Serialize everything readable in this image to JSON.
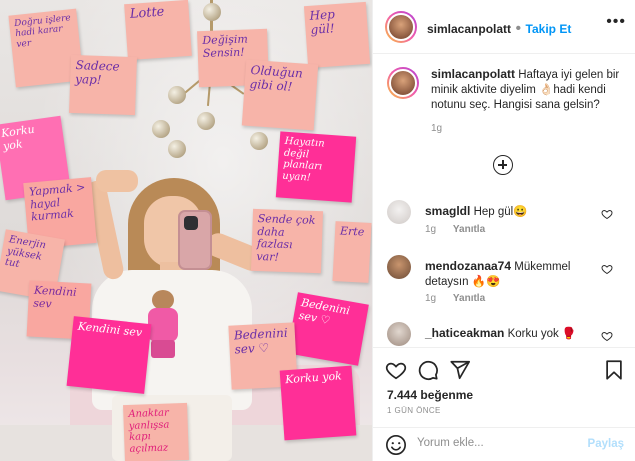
{
  "post": {
    "username": "simlacanpolatt",
    "follow_label": "Takip Et",
    "caption_username": "simlacanpolatt",
    "caption_text": "Haftaya iyi gelen bir minik aktivite diyelim 👌🏻hadi kendi notunu seç. Hangisi sana gelsin?",
    "caption_time": "1g",
    "likes": "7.444 beğenme",
    "date": "1 GÜN ÖNCE",
    "comment_placeholder": "Yorum ekle...",
    "post_label": "Paylaş"
  },
  "comments": [
    {
      "user": "smagldl",
      "text": "Hep gül😀",
      "time": "1g",
      "reply": "Yanıtla"
    },
    {
      "user": "mendozanaa74",
      "text": "Mükemmel detaysın 🔥😍",
      "time": "1g",
      "reply": "Yanıtla"
    },
    {
      "user": "_haticeakman",
      "text": "Korku yok 🥊"
    }
  ],
  "notes": {
    "n1": "Doğru işlere hadi karar ver",
    "n2": "Lotte",
    "n3": "Değişim Sensin!",
    "n4": "Hep gül!",
    "n5": "Sadece yap!",
    "n6": "Olduğun gibi ol!",
    "n7": "Korku yok",
    "n8": "Hayatın değil planları uyan!",
    "n9": "Yapmak > hayal kurmak",
    "n10": "Sende çok daha fazlası var!",
    "n11": "Enerjin yüksek tut",
    "n12": "Erte",
    "n13": "Kendini sev",
    "n14": "Bedenini sev ♡",
    "n15": "Anaktar yanlışsa kapı açılmaz"
  },
  "colors": {
    "accent_blue": "#0095f6",
    "note_peach": "#f7b4a9",
    "note_pink": "#ff6fb3",
    "note_hot": "#ff2f97"
  },
  "icons": [
    "heart-icon",
    "comment-icon",
    "share-icon",
    "bookmark-icon",
    "emoji-icon",
    "more-icon",
    "add-circle-icon"
  ]
}
